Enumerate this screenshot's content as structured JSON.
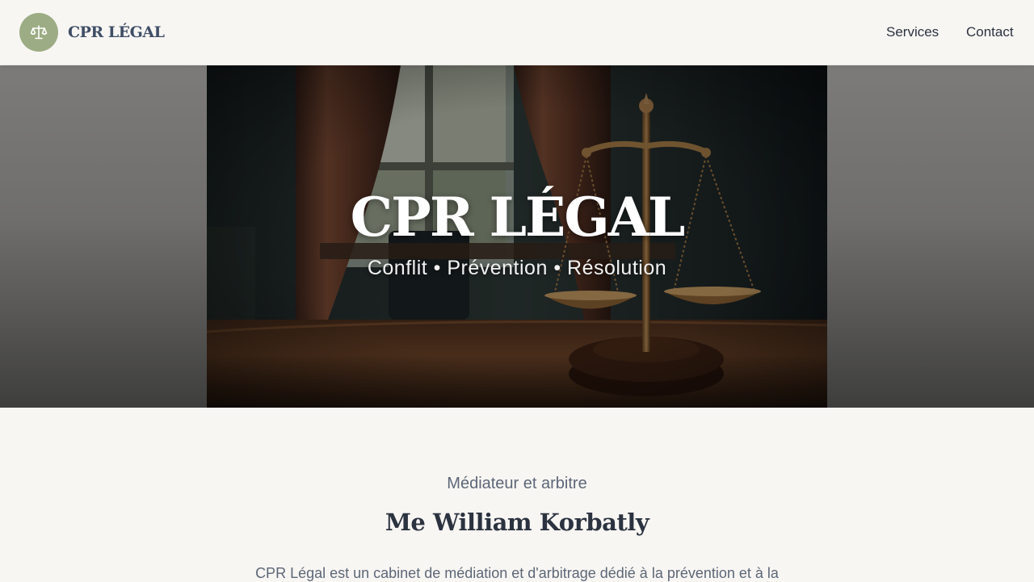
{
  "header": {
    "logo_icon": "scales-icon",
    "brand": "CPR LÉGAL",
    "nav": {
      "services": "Services",
      "contact": "Contact"
    }
  },
  "hero": {
    "title": "CPR LÉGAL",
    "subtitle": "Conflit • Prévention • Résolution"
  },
  "about": {
    "eyebrow": "Médiateur et arbitre",
    "name": "Me William Korbatly",
    "intro": "CPR Légal est un cabinet de médiation et d'arbitrage dédié à la prévention et à la"
  },
  "colors": {
    "background": "#f8f6f3",
    "logo_circle": "#9cac84",
    "brand_text": "#3f4e66",
    "heading_text": "#2b3340",
    "muted_text": "#5d6777"
  }
}
